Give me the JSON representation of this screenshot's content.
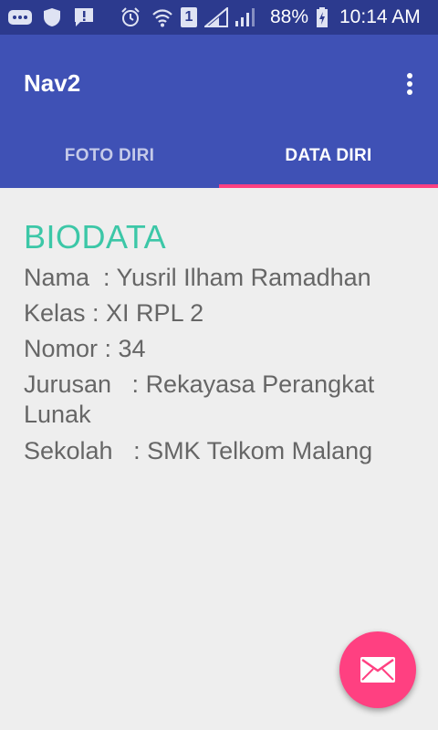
{
  "status_bar": {
    "battery": "88%",
    "time": "10:14 AM",
    "sim_slot": "1",
    "icons": [
      "messenger-icon",
      "shield-icon",
      "alert-icon",
      "alarm-icon",
      "wifi-icon",
      "sim-icon",
      "signal-icon",
      "signal-icon",
      "battery-charging-icon"
    ]
  },
  "app_bar": {
    "title": "Nav2",
    "menu_icon": "more-vert-icon"
  },
  "tabs": [
    {
      "label": "FOTO DIRI",
      "selected": false
    },
    {
      "label": "DATA DIRI",
      "selected": true
    }
  ],
  "biodata": {
    "title": "BIODATA",
    "lines": [
      "Nama  : Yusril Ilham Ramadhan",
      "Kelas : XI RPL 2",
      "Nomor : 34",
      "Jurusan   : Rekayasa Perangkat Lunak",
      "Sekolah   : SMK Telkom Malang"
    ]
  },
  "fab": {
    "icon": "mail-icon"
  },
  "colors": {
    "status_bar": "#2c3a8e",
    "primary": "#3f51b5",
    "accent": "#ff4081",
    "title_green": "#3cc7a7",
    "body_text": "#666666",
    "background": "#eeeeee"
  }
}
